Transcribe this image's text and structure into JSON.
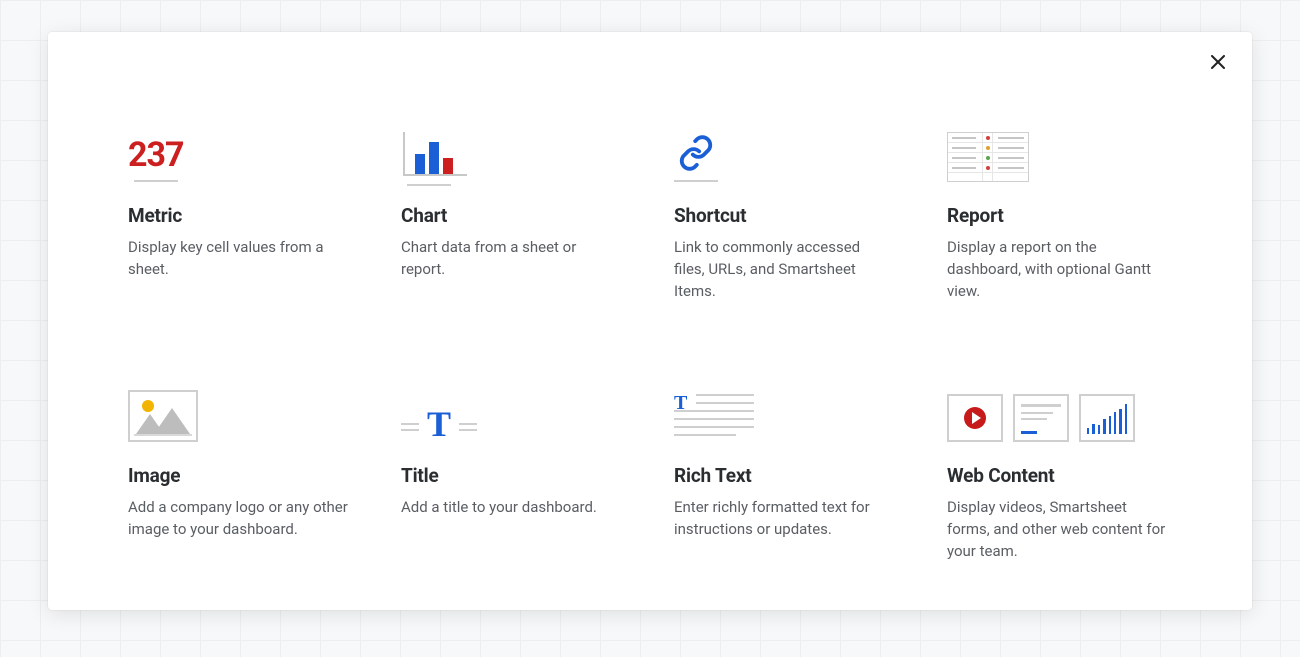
{
  "metric_sample": "237",
  "cards": [
    {
      "title": "Metric",
      "desc": "Display key cell values from a sheet."
    },
    {
      "title": "Chart",
      "desc": "Chart data from a sheet or report."
    },
    {
      "title": "Shortcut",
      "desc": "Link to commonly accessed files, URLs, and Smartsheet Items."
    },
    {
      "title": "Report",
      "desc": "Display a report on the dashboard, with optional Gantt view."
    },
    {
      "title": "Image",
      "desc": "Add a company logo or any other image to your dashboard."
    },
    {
      "title": "Title",
      "desc": "Add a title to your dashboard."
    },
    {
      "title": "Rich Text",
      "desc": "Enter richly formatted text for instructions or updates."
    },
    {
      "title": "Web Content",
      "desc": "Display videos, Smartsheet forms, and other web content for your team."
    }
  ]
}
